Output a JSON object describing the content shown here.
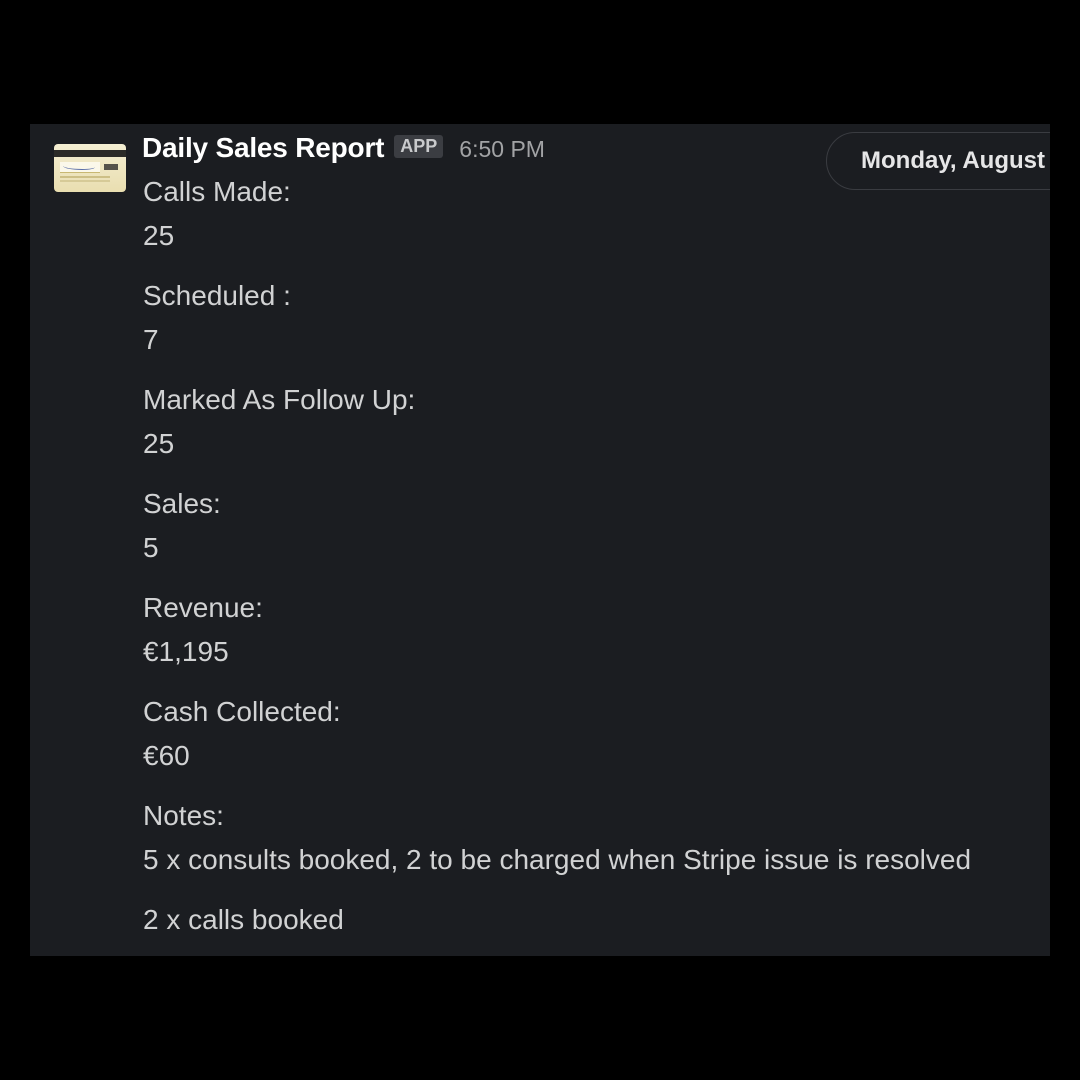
{
  "message": {
    "sender": "Daily Sales Report",
    "badge": "APP",
    "time": "6:50 PM",
    "avatar": "credit-card-icon"
  },
  "date_divider": "Monday, August",
  "fields": [
    {
      "label": "Calls Made:",
      "value": "25"
    },
    {
      "label": "Scheduled :",
      "value": "7"
    },
    {
      "label": "Marked As Follow Up:",
      "value": "25"
    },
    {
      "label": "Sales:",
      "value": "5"
    },
    {
      "label": "Revenue:",
      "value": "€1,195"
    },
    {
      "label": "Cash Collected:",
      "value": "€60"
    },
    {
      "label": "Notes:",
      "value": "5 x consults booked, 2 to be charged when Stripe issue is resolved"
    }
  ],
  "notes_extra": "2 x calls booked",
  "colors": {
    "background": "#000000",
    "panel": "#1b1d21",
    "text": "#d1d2d3",
    "sender": "#ffffff",
    "muted": "#a2a3a5"
  }
}
